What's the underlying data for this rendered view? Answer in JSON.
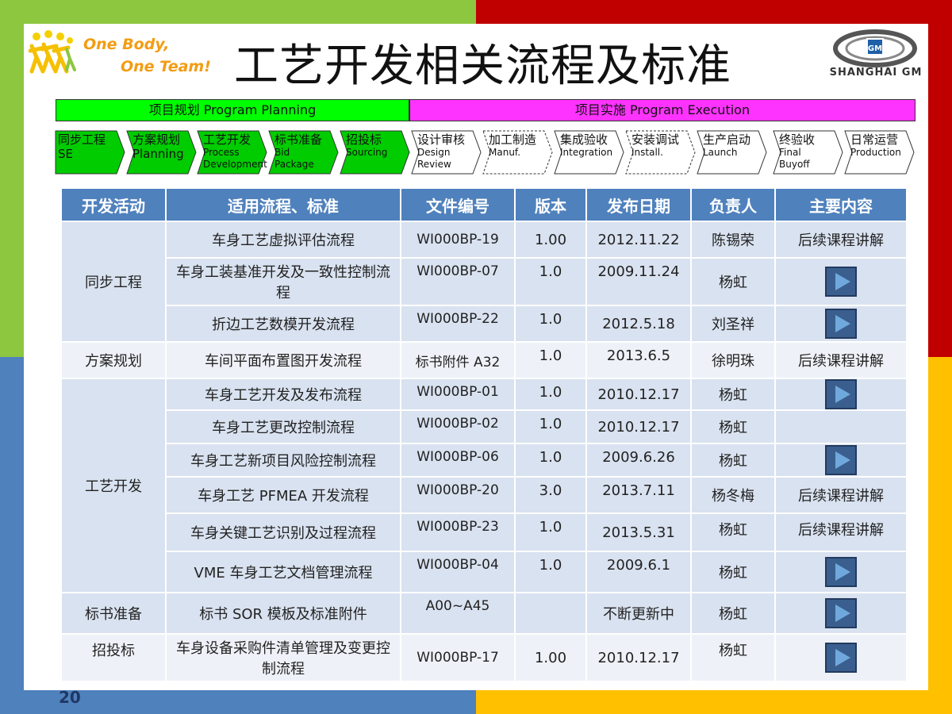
{
  "header": {
    "slogan_line1": "One Body,",
    "slogan_line2": "One Team!",
    "title": "工艺开发相关流程及标准",
    "brand": "SHANGHAI GM",
    "gm_mark": "GM"
  },
  "phases": {
    "planning": "项目规划   Program Planning",
    "execution": "项目实施   Program Execution"
  },
  "steps": [
    {
      "cn": "同步工程",
      "en": "SE",
      "fill": "#00cc00"
    },
    {
      "cn": "方案规划",
      "en": "Planning",
      "fill": "#00cc00"
    },
    {
      "cn": "工艺开发",
      "en": "Process Development",
      "fill": "#00cc00"
    },
    {
      "cn": "标书准备",
      "en": "Bid Package",
      "fill": "#00cc00"
    },
    {
      "cn": "招投标",
      "en": "Sourcing",
      "fill": "#00cc00"
    },
    {
      "cn": "设计审核",
      "en": "Design Review",
      "fill": "#ffffff"
    },
    {
      "cn": "加工制造",
      "en": "Manuf.",
      "fill": "#ffffff"
    },
    {
      "cn": "集成验收",
      "en": "Integration",
      "fill": "#ffffff"
    },
    {
      "cn": "安装调试",
      "en": "Install.",
      "fill": "#ffffff"
    },
    {
      "cn": "生产启动",
      "en": "Launch",
      "fill": "#ffffff"
    },
    {
      "cn": "终验收",
      "en": "Final Buyoff",
      "fill": "#ffffff"
    },
    {
      "cn": "日常运营",
      "en": "Production",
      "fill": "#ffffff"
    }
  ],
  "table": {
    "headers": [
      "开发活动",
      "适用流程、标准",
      "文件编号",
      "版本",
      "发布日期",
      "负责人",
      "主要内容"
    ],
    "groups": {
      "se": "同步工程",
      "planning": "方案规划",
      "process": "工艺开发",
      "bid": "标书准备",
      "sourcing": "招投标"
    },
    "rows": [
      {
        "process": "车身工艺虚拟评估流程",
        "code": "WI000BP-19",
        "version": "1.00",
        "date": "2012.11.22",
        "owner": "陈锡荣",
        "content": "后续课程讲解"
      },
      {
        "process": "车身工装基准开发及一致性控制流程",
        "code": "WI000BP-07",
        "version": "1.0",
        "date": "2009.11.24",
        "owner": "杨虹",
        "content": ""
      },
      {
        "process": "折边工艺数模开发流程",
        "code": "WI000BP-22",
        "version": "1.0",
        "date": "2012.5.18",
        "owner": "刘圣祥",
        "content": ""
      },
      {
        "process": "车间平面布置图开发流程",
        "code": "标书附件 A32",
        "version": "1.0",
        "date": "2013.6.5",
        "owner": "徐明珠",
        "content": "后续课程讲解"
      },
      {
        "process": "车身工艺开发及发布流程",
        "code": "WI000BP-01",
        "version": "1.0",
        "date": "2010.12.17",
        "owner": "杨虹",
        "content": ""
      },
      {
        "process": "车身工艺更改控制流程",
        "code": "WI000BP-02",
        "version": "1.0",
        "date": "2010.12.17",
        "owner": "杨虹",
        "content": ""
      },
      {
        "process": "车身工艺新项目风险控制流程",
        "code": "WI000BP-06",
        "version": "1.0",
        "date": "2009.6.26",
        "owner": "杨虹",
        "content": ""
      },
      {
        "process": "车身工艺 PFMEA 开发流程",
        "code": "WI000BP-20",
        "version": "3.0",
        "date": "2013.7.11",
        "owner": "杨冬梅",
        "content": "后续课程讲解"
      },
      {
        "process": "车身关键工艺识别及过程流程",
        "code": "WI000BP-23",
        "version": "1.0",
        "date": "2013.5.31",
        "owner": "杨虹",
        "content": "后续课程讲解"
      },
      {
        "process": "VME 车身工艺文档管理流程",
        "code": "WI000BP-04",
        "version": "1.0",
        "date": "2009.6.1",
        "owner": "杨虹",
        "content": ""
      },
      {
        "process": "标书 SOR 模板及标准附件",
        "code": "A00~A45",
        "version": "",
        "date": "不断更新中",
        "owner": "杨虹",
        "content": ""
      },
      {
        "process": "车身设备采购件清单管理及变更控制流程",
        "code": "WI000BP-17",
        "version": "1.00",
        "date": "2010.12.17",
        "owner": "杨虹",
        "content": ""
      }
    ]
  },
  "page_number": "20"
}
